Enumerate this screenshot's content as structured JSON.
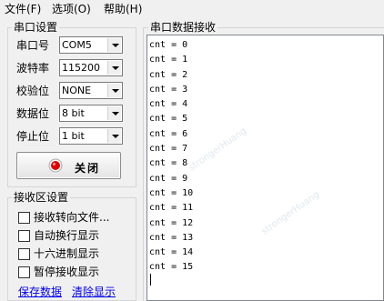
{
  "menu": {
    "file": "文件(F)",
    "options": "选项(O)",
    "help": "帮助(H)"
  },
  "serial_settings": {
    "title": "串口设置",
    "port_label": "串口号",
    "port_value": "COM5",
    "baud_label": "波特率",
    "baud_value": "115200",
    "parity_label": "校验位",
    "parity_value": "NONE",
    "databits_label": "数据位",
    "databits_value": "8 bit",
    "stopbits_label": "停止位",
    "stopbits_value": "1 bit",
    "close_button": "关闭",
    "led_color": "#e00000"
  },
  "rx_settings": {
    "title": "接收区设置",
    "options": [
      {
        "label": "接收转向文件...",
        "checked": false
      },
      {
        "label": "自动换行显示",
        "checked": false
      },
      {
        "label": "十六进制显示",
        "checked": false
      },
      {
        "label": "暂停接收显示",
        "checked": false
      }
    ],
    "save_link": "保存数据",
    "clear_link": "清除显示"
  },
  "rx_panel": {
    "title": "串口数据接收",
    "lines": [
      "cnt = 0",
      "cnt = 1",
      "cnt = 2",
      "cnt = 3",
      "cnt = 4",
      "cnt = 5",
      "cnt = 6",
      "cnt = 7",
      "cnt = 8",
      "cnt = 9",
      "cnt = 10",
      "cnt = 11",
      "cnt = 12",
      "cnt = 13",
      "cnt = 14",
      "cnt = 15"
    ]
  },
  "watermark": "strongerHuang"
}
